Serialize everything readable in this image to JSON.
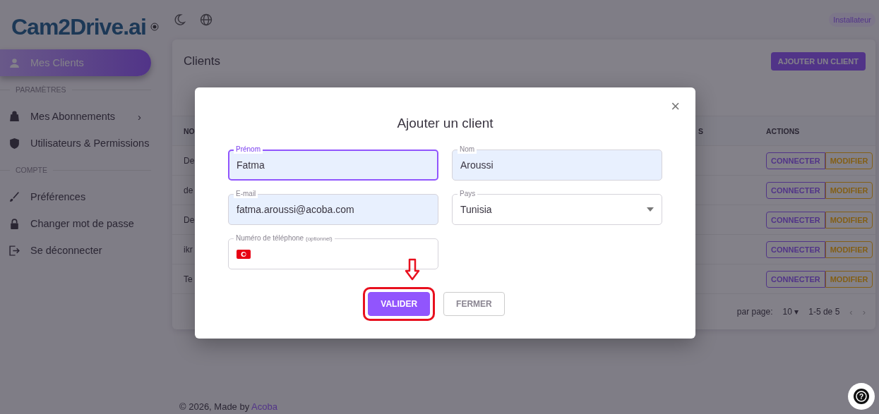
{
  "brand": {
    "name": "Cam2Drive.ai"
  },
  "topbar": {
    "role_badge": "Installateur"
  },
  "sidebar": {
    "items": [
      {
        "kind": "item",
        "label": "Mes Clients",
        "selected": true
      },
      {
        "kind": "section",
        "label": "PARAMÈTRES"
      },
      {
        "kind": "item",
        "label": "Mes Abonnements",
        "selected": false,
        "expand_glyph": "›"
      },
      {
        "kind": "item",
        "label": "Utilisateurs & Permissions",
        "selected": false
      },
      {
        "kind": "section",
        "label": "COMPTE"
      },
      {
        "kind": "item",
        "label": "Préférences",
        "selected": false
      },
      {
        "kind": "item",
        "label": "Changer mot de passe",
        "selected": false
      },
      {
        "kind": "item",
        "label": "Se déconnecter",
        "selected": false
      }
    ]
  },
  "clients_card": {
    "title": "Clients",
    "add_button": "AJOUTER UN CLIENT",
    "table": {
      "columns": [
        "NO",
        "S",
        "ACTIONS"
      ],
      "rows": [
        {
          "column_1": "De",
          "actions": [
            "CONNECTER",
            "MODIFIER"
          ]
        },
        {
          "column_1": "de",
          "actions": [
            "CONNECTER",
            "MODIFIER"
          ]
        },
        {
          "column_1": "De",
          "actions": [
            "CONNECTER",
            "MODIFIER"
          ]
        },
        {
          "column_1": "ikr",
          "actions": [
            "CONNECTER",
            "MODIFIER"
          ]
        },
        {
          "column_1": "Te",
          "actions": [
            "CONNECTER",
            "MODIFIER"
          ]
        }
      ]
    },
    "pagination": {
      "rows_per_page_label": "par page:",
      "rows_per_page": "10",
      "dropdown_glyph": "▾",
      "range": "1-5 de 5",
      "previous": "‹",
      "next": "›"
    }
  },
  "help_button": "?",
  "footer": {
    "text": "© 2026, Made by ",
    "link": "Acoba"
  },
  "dialog": {
    "title": "Ajouter un client",
    "close": "×",
    "fields": [
      {
        "kind": "text",
        "label": "Prénom",
        "value": "Fatma",
        "focused": true,
        "autofilled": true
      },
      {
        "kind": "text",
        "label": "Nom",
        "value": "Aroussi",
        "focused": false,
        "autofilled": true
      },
      {
        "kind": "text",
        "label": "E-mail",
        "value": "fatma.aroussi@acoba.com",
        "focused": false,
        "autofilled": true
      },
      {
        "kind": "select",
        "label": "Pays",
        "value": "Tunisia",
        "focused": false,
        "autofilled": false
      },
      {
        "kind": "phone",
        "label": "Numéro de téléphone",
        "hint": "(optionnel)",
        "focused": false,
        "autofilled": false
      }
    ],
    "buttons": [
      {
        "label": "VALIDER",
        "kind": "primary",
        "highlighted": true
      },
      {
        "label": "FERMER",
        "kind": "secondary",
        "highlighted": false
      }
    ]
  }
}
